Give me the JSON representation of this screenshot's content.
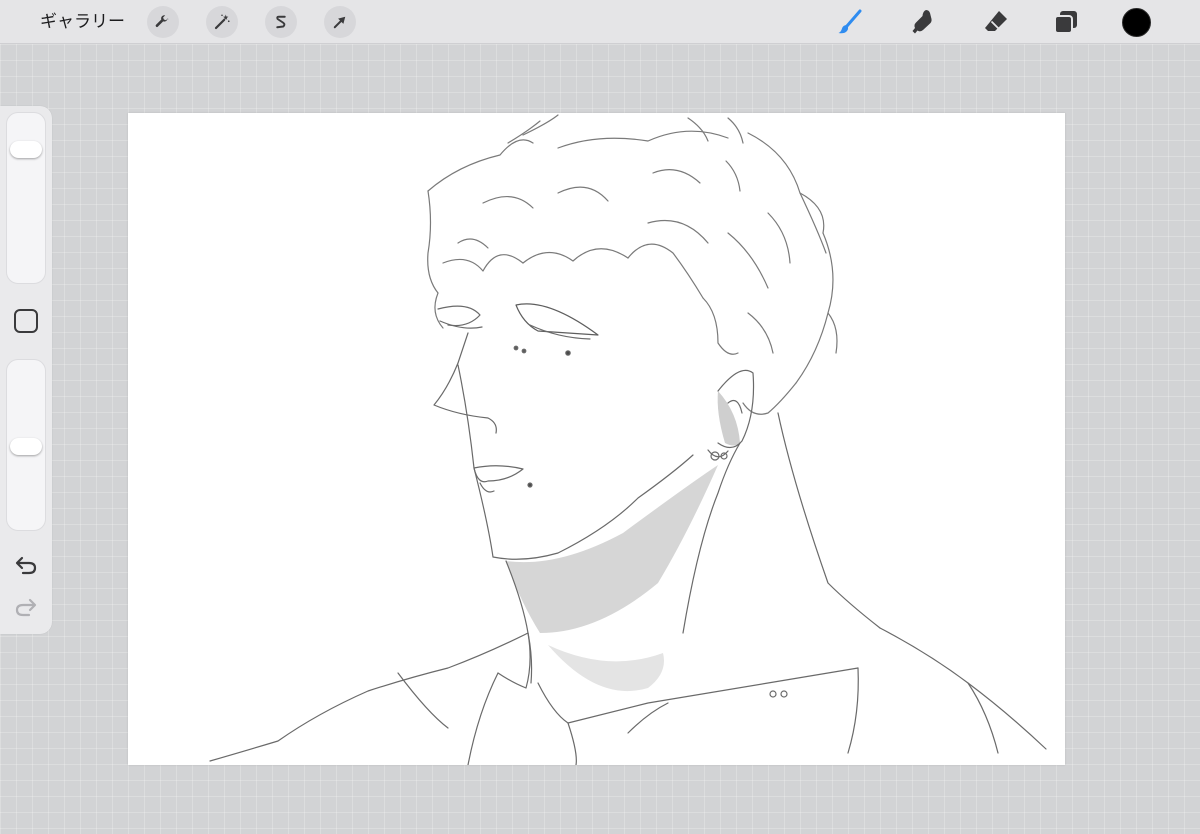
{
  "toolbar": {
    "gallery_label": "ギャラリー",
    "left_tools": [
      {
        "name": "actions",
        "icon": "wrench-icon"
      },
      {
        "name": "adjustments",
        "icon": "magic-wand-icon"
      },
      {
        "name": "selection",
        "icon": "selection-s-icon"
      },
      {
        "name": "transform",
        "icon": "arrow-cursor-icon"
      }
    ],
    "right_tools": [
      {
        "name": "brush",
        "icon": "brush-icon",
        "active": true
      },
      {
        "name": "smudge",
        "icon": "smudge-finger-icon",
        "active": false
      },
      {
        "name": "eraser",
        "icon": "eraser-icon",
        "active": false
      },
      {
        "name": "layers",
        "icon": "layers-icon",
        "active": false
      }
    ],
    "active_color": "#000000",
    "accent_color": "#2f8cf0"
  },
  "sidebar": {
    "brush_size_level": 0.17,
    "opacity_level": 0.51,
    "modify_icon": "square-icon",
    "undo_icon": "undo-arrow-icon",
    "redo_icon": "redo-arrow-icon",
    "redo_enabled": false
  },
  "canvas": {
    "background": "#ffffff",
    "content": "pencil-sketch-portrait"
  }
}
